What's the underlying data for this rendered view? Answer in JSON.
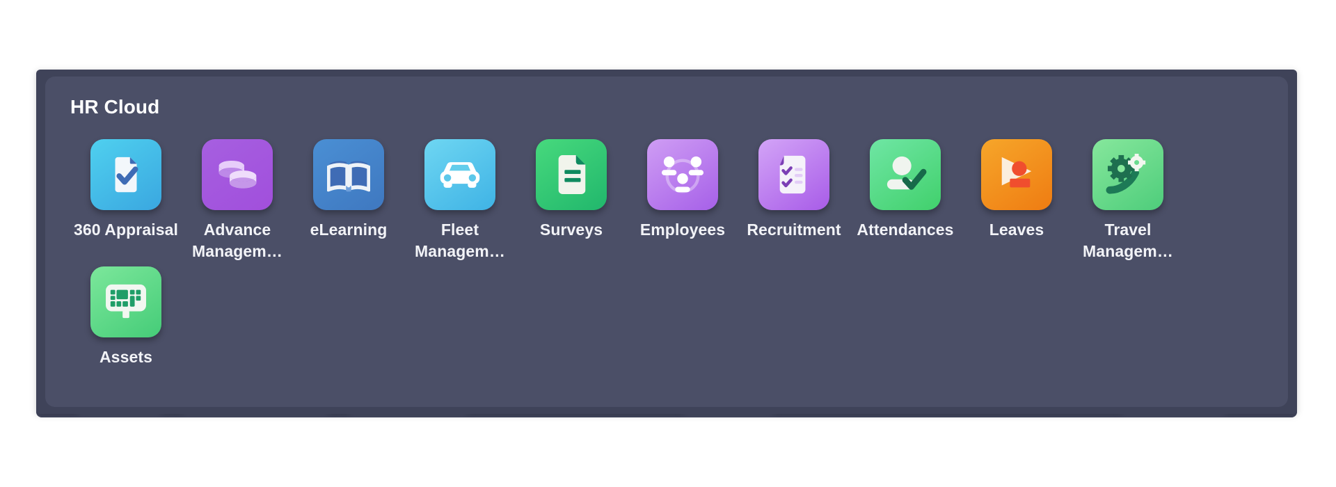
{
  "panel": {
    "group_title": "HR Cloud",
    "background_color": "#4b4f67",
    "shell_color": "#3f4359"
  },
  "apps": [
    {
      "id": "360-appraisal",
      "label": "360 Appraisal",
      "icon": "document-check-icon",
      "tile_from": "#4fd0ef",
      "tile_to": "#3aa7e0",
      "accent": "#3f6cb5"
    },
    {
      "id": "advance-management",
      "label": "Advance Managem…",
      "icon": "coins-stack-icon",
      "tile_from": "#a65fe0",
      "tile_to": "#a14fdc",
      "accent": "#e3c4f7"
    },
    {
      "id": "elearning",
      "label": "eLearning",
      "icon": "open-book-icon",
      "tile_from": "#4a8fd4",
      "tile_to": "#3f78c0",
      "accent": "#edf2f7"
    },
    {
      "id": "fleet-management",
      "label": "Fleet Managem…",
      "icon": "car-icon",
      "tile_from": "#6ed6f2",
      "tile_to": "#3fb3e5",
      "accent": "#ffffff"
    },
    {
      "id": "surveys",
      "label": "Surveys",
      "icon": "survey-document-icon",
      "tile_from": "#47d97d",
      "tile_to": "#21b76c",
      "accent": "#0f8a5f"
    },
    {
      "id": "employees",
      "label": "Employees",
      "icon": "people-group-icon",
      "tile_from": "#cf9df4",
      "tile_to": "#a660e8",
      "accent": "#ffffff"
    },
    {
      "id": "recruitment",
      "label": "Recruitment",
      "icon": "checklist-document-icon",
      "tile_from": "#d3a4f7",
      "tile_to": "#a85ce8",
      "accent": "#7b3fb5"
    },
    {
      "id": "attendances",
      "label": "Attendances",
      "icon": "user-check-icon",
      "tile_from": "#6fe6a4",
      "tile_to": "#41d06c",
      "accent": "#17694a"
    },
    {
      "id": "leaves",
      "label": "Leaves",
      "icon": "flag-person-icon",
      "tile_from": "#f6a62a",
      "tile_to": "#ef7c12",
      "accent": "#f04e2e"
    },
    {
      "id": "travel-management",
      "label": "Travel Managem…",
      "icon": "gears-growth-icon",
      "tile_from": "#86e79c",
      "tile_to": "#4ecd7b",
      "accent": "#1d7a56"
    },
    {
      "id": "assets",
      "label": "Assets",
      "icon": "monitor-blocks-icon",
      "tile_from": "#7ce79b",
      "tile_to": "#45cc78",
      "accent": "#1f9e68"
    }
  ]
}
